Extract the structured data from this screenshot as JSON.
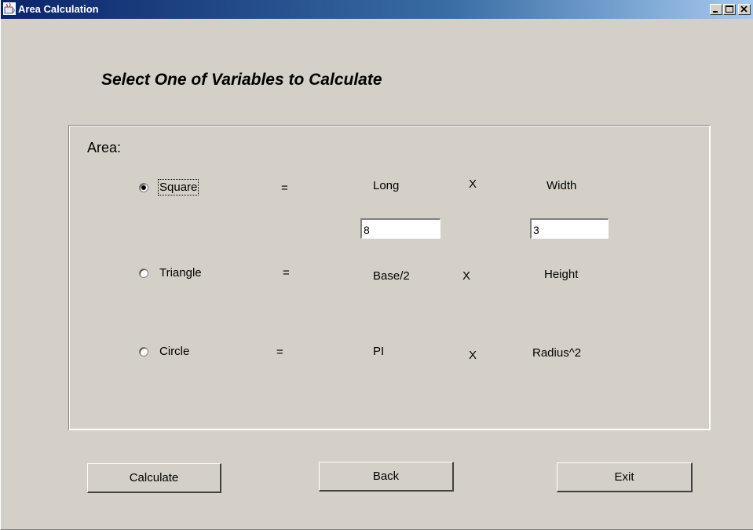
{
  "window": {
    "title": "Area Calculation",
    "controls": [
      "minimize-icon",
      "maximize-icon",
      "close-icon"
    ]
  },
  "heading": "Select One of Variables to Calculate",
  "panel": {
    "area_label": "Area:",
    "equals": "=",
    "times": "X",
    "rows": [
      {
        "shape": "Square",
        "selected": true,
        "term1": "Long",
        "term2": "Width",
        "value1": "8",
        "value2": "3"
      },
      {
        "shape": "Triangle",
        "selected": false,
        "term1": "Base/2",
        "term2": "Height"
      },
      {
        "shape": "Circle",
        "selected": false,
        "term1": "PI",
        "term2": "Radius^2"
      }
    ]
  },
  "buttons": {
    "calculate": "Calculate",
    "back": "Back",
    "exit": "Exit"
  }
}
